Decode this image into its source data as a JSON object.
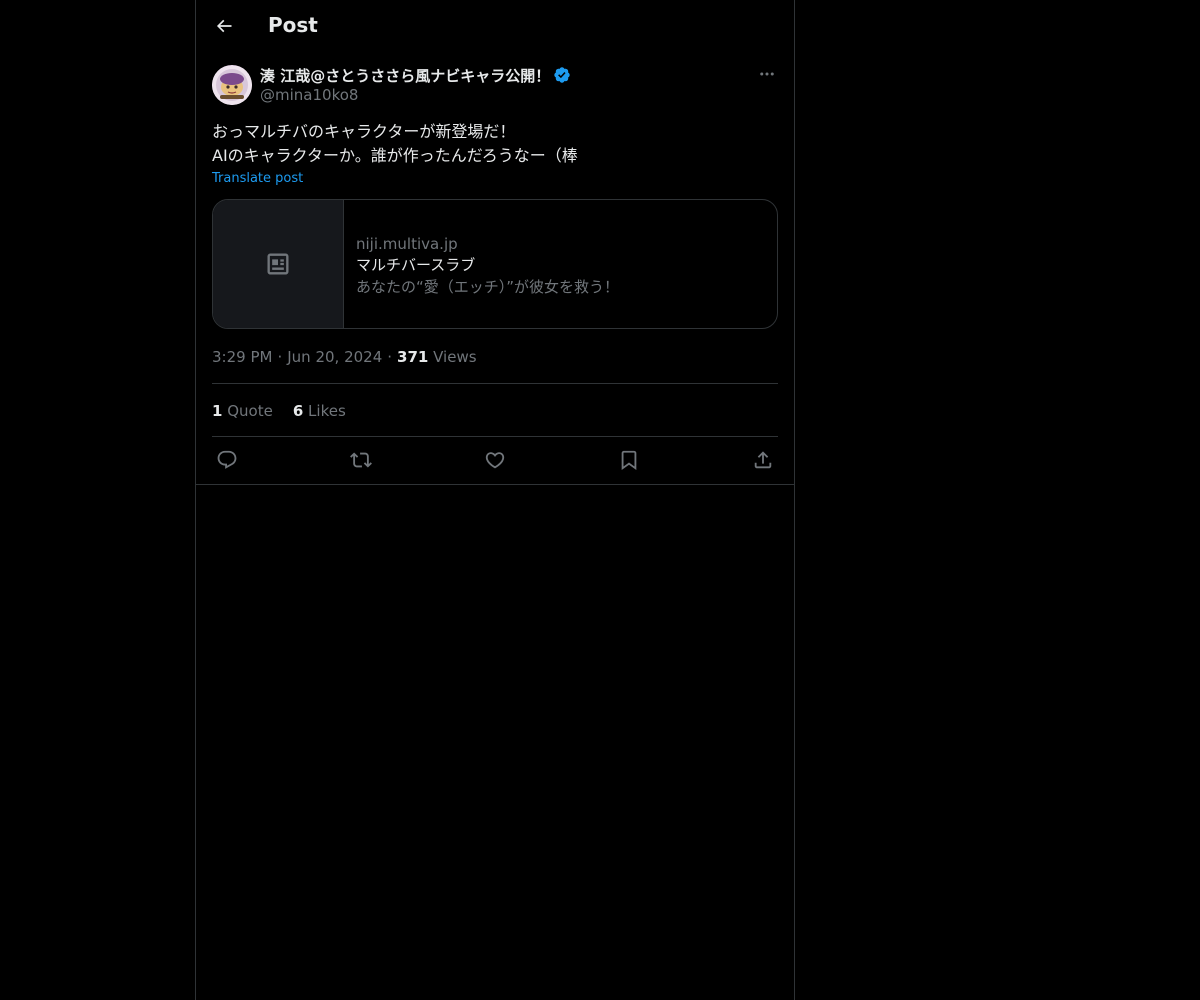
{
  "header": {
    "title": "Post",
    "back_icon": "arrow-left-icon"
  },
  "post": {
    "author": {
      "display_name": "湊 江哉@さとうささら風ナビキャラ公開！",
      "handle": "@mina10ko8",
      "verified": true,
      "verified_color": "#1d9bf0"
    },
    "text_lines": [
      "おっマルチバのキャラクターが新登場だ！",
      "AIのキャラクターか。誰が作ったんだろうなー（棒"
    ],
    "translate_label": "Translate post",
    "card": {
      "domain": "niji.multiva.jp",
      "title": "マルチバースラブ",
      "description": "あなたの“愛（エッチ）”が彼女を救う！",
      "thumb_icon": "article-icon"
    },
    "time": "3:29 PM",
    "date": "Jun 20, 2024",
    "views_count": "371",
    "views_label": "Views",
    "quotes_count": "1",
    "quotes_label": "Quote",
    "likes_count": "6",
    "likes_label": "Likes",
    "actions": [
      "reply-icon",
      "repost-icon",
      "like-icon",
      "bookmark-icon",
      "share-icon"
    ]
  },
  "colors": {
    "background": "#000000",
    "text": "#e7e9ea",
    "secondary": "#71767b",
    "border": "#2f3336",
    "accent": "#1d9bf0"
  }
}
